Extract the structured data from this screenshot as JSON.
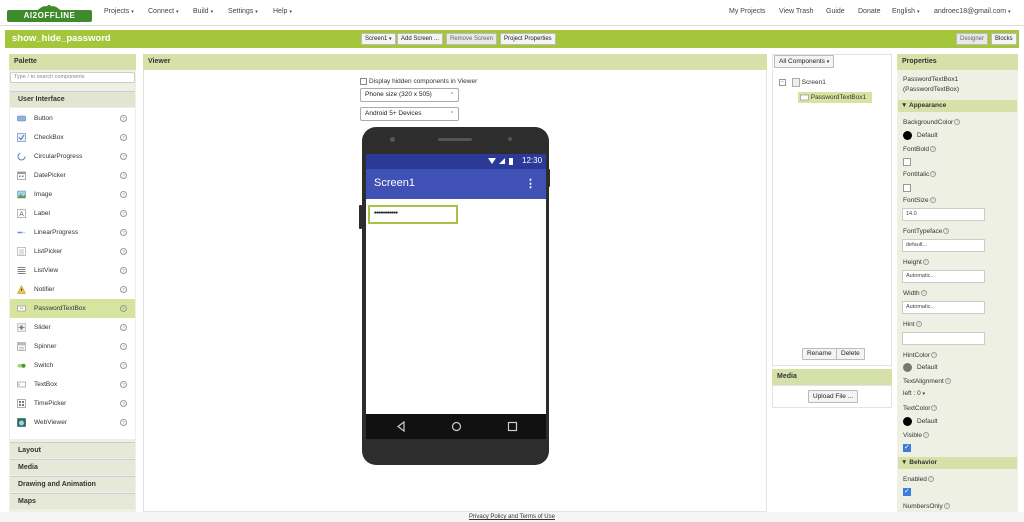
{
  "nav": {
    "logo_text": "AI2OFFLINE",
    "menus": [
      "Projects",
      "Connect",
      "Build",
      "Settings",
      "Help"
    ],
    "my_projects": "My Projects",
    "view_trash": "View Trash",
    "guide": "Guide",
    "donate": "Donate",
    "language": "English",
    "user": "androec18@gmail.com"
  },
  "project": {
    "name": "show_hide_password",
    "screen_select": "Screen1",
    "add_screen": "Add Screen ...",
    "remove_screen": "Remove Screen",
    "project_properties": "Project Properties",
    "designer": "Designer",
    "blocks": "Blocks"
  },
  "palette": {
    "title": "Palette",
    "search_placeholder": "Type / to search components",
    "section_user_interface": "User Interface",
    "items": [
      {
        "label": "Button",
        "icon": "button-icon"
      },
      {
        "label": "CheckBox",
        "icon": "checkbox-icon"
      },
      {
        "label": "CircularProgress",
        "icon": "circular-progress-icon"
      },
      {
        "label": "DatePicker",
        "icon": "datepicker-icon"
      },
      {
        "label": "Image",
        "icon": "image-icon"
      },
      {
        "label": "Label",
        "icon": "label-icon"
      },
      {
        "label": "LinearProgress",
        "icon": "linear-progress-icon"
      },
      {
        "label": "ListPicker",
        "icon": "listpicker-icon"
      },
      {
        "label": "ListView",
        "icon": "listview-icon"
      },
      {
        "label": "Notifier",
        "icon": "notifier-icon"
      },
      {
        "label": "PasswordTextBox",
        "icon": "password-textbox-icon"
      },
      {
        "label": "Slider",
        "icon": "slider-icon"
      },
      {
        "label": "Spinner",
        "icon": "spinner-icon"
      },
      {
        "label": "Switch",
        "icon": "switch-icon"
      },
      {
        "label": "TextBox",
        "icon": "textbox-icon"
      },
      {
        "label": "TimePicker",
        "icon": "timepicker-icon"
      },
      {
        "label": "WebViewer",
        "icon": "webviewer-icon"
      }
    ],
    "selected_item": "PasswordTextBox",
    "help_glyph": "?",
    "sections": [
      "Layout",
      "Media",
      "Drawing and Animation",
      "Maps"
    ]
  },
  "viewer": {
    "title": "Viewer",
    "display_hidden": "Display hidden components in Viewer",
    "phone_size": "Phone size (320 x 505)",
    "android_version": "Android 5+ Devices",
    "status_time": "12:30",
    "screen_title": "Screen1",
    "password_value": "••••••••••••"
  },
  "components": {
    "selector": "All Components",
    "tree": [
      "Screen1",
      "PasswordTextBox1"
    ],
    "rename": "Rename",
    "delete": "Delete",
    "media_title": "Media",
    "upload_file": "Upload File ..."
  },
  "properties": {
    "title": "Properties",
    "component_name": "PasswordTextBox1",
    "component_type": "(PasswordTextBox)",
    "section_appearance": "Appearance",
    "section_behavior": "Behavior",
    "background_color_label": "BackgroundColor",
    "background_color_value": "Default",
    "font_bold_label": "FontBold",
    "font_italic_label": "FontItalic",
    "font_size_label": "FontSize",
    "font_size_value": "14.0",
    "font_typeface_label": "FontTypeface",
    "font_typeface_value": "default...",
    "height_label": "Height",
    "height_value": "Automatic...",
    "width_label": "Width",
    "width_value": "Automatic...",
    "hint_label": "Hint",
    "hint_value": "",
    "hint_color_label": "HintColor",
    "hint_color_value": "Default",
    "text_alignment_label": "TextAlignment",
    "text_alignment_value": "left : 0",
    "text_color_label": "TextColor",
    "text_color_value": "Default",
    "visible_label": "Visible",
    "enabled_label": "Enabled",
    "numbers_only_label": "NumbersOnly",
    "visible_checked": true,
    "enabled_checked": true
  },
  "footer": {
    "text": "Privacy Policy and Terms of Use"
  },
  "colors": {
    "accent": "#a5c63b",
    "panel_header": "#d5e1a8",
    "app_bar": "#3f51b5",
    "status_bar": "#2b3a97"
  }
}
